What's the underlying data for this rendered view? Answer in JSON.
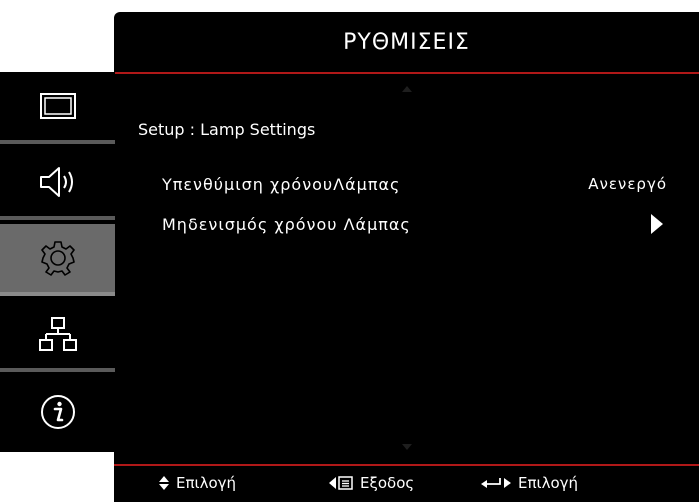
{
  "osd": {
    "title": "ΡΥΘΜΙΣΕΙΣ",
    "breadcrumb": "Setup : Lamp Settings",
    "items": [
      {
        "label": "Υπενθύμιση χρόνουΛάμπας",
        "value": "Ανενεργό"
      },
      {
        "label": "Μηδενισμός χρόνου Λάμπας",
        "value_icon": "triangle-right-icon"
      }
    ]
  },
  "sidebar": {
    "items": [
      {
        "icon": "display-icon",
        "active": false
      },
      {
        "icon": "speaker-icon",
        "active": false
      },
      {
        "icon": "gear-icon",
        "active": true
      },
      {
        "icon": "network-icon",
        "active": false
      },
      {
        "icon": "info-icon",
        "active": false
      }
    ]
  },
  "footer": {
    "select_label": "Επιλογή",
    "exit_label": "Εξοδος",
    "enter_label": "Επιλογή"
  },
  "colors": {
    "accent": "#b01818",
    "active_item": "#6a6a6a",
    "background": "#000000"
  }
}
